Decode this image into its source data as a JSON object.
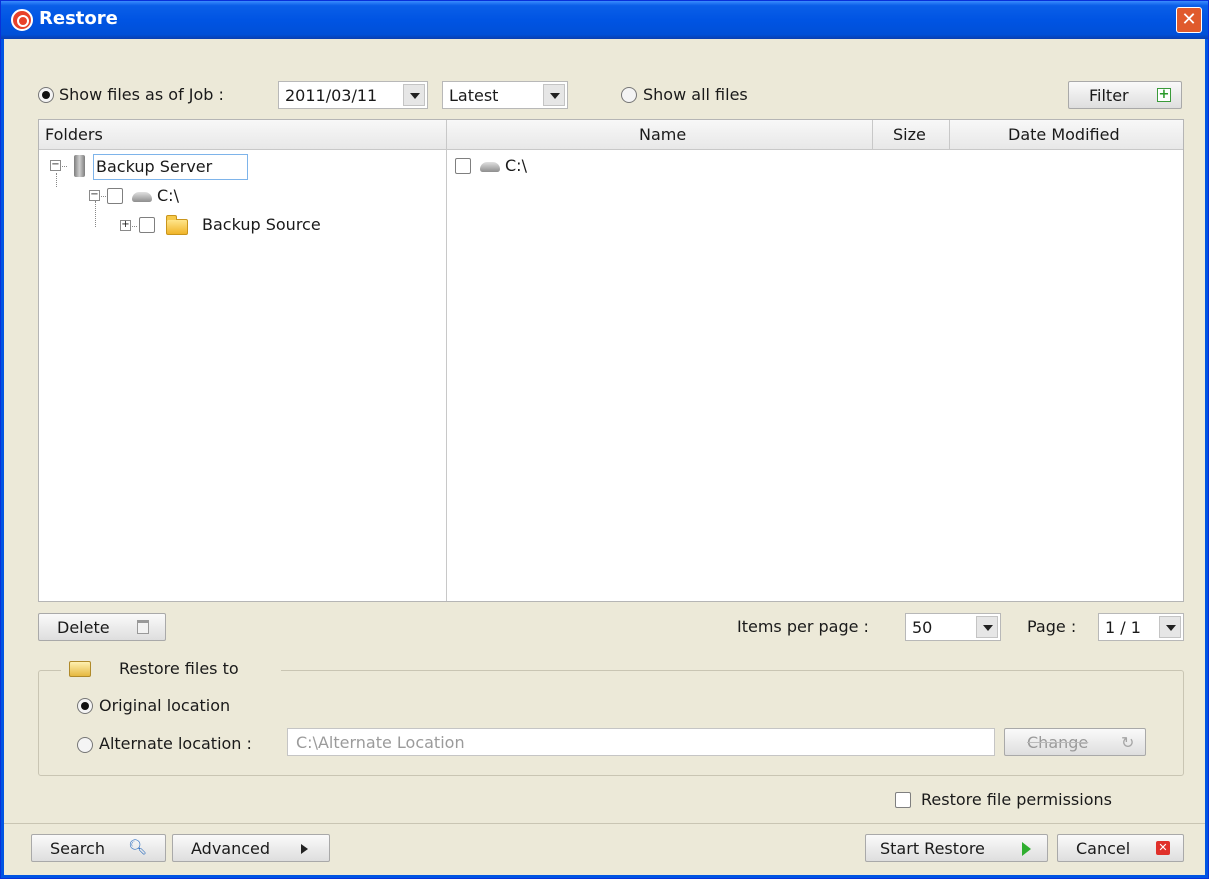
{
  "window": {
    "title": "Restore",
    "close_icon": "close-icon"
  },
  "job_selector": {
    "show_as_of_job_label": "Show files as of Job :",
    "job_date": "2011/03/11",
    "job_version": "Latest",
    "show_all_label": "Show all files",
    "filter_label": "Filter"
  },
  "tree": {
    "header": "Folders",
    "nodes": [
      {
        "label": "Backup Server",
        "icon": "server-icon"
      },
      {
        "label": "C:\\",
        "icon": "drive-icon"
      },
      {
        "label": "Backup Source",
        "icon": "folder-icon"
      }
    ]
  },
  "file_list": {
    "columns": [
      "Name",
      "Size",
      "Date Modified"
    ],
    "rows": [
      {
        "name": "C:\\",
        "icon": "drive-icon"
      }
    ]
  },
  "list_controls": {
    "delete_label": "Delete",
    "items_per_page_label": "Items per page :",
    "items_per_page": "50",
    "page_label": "Page :",
    "page_value": "1 / 1"
  },
  "restore_to": {
    "group_title": "Restore files to",
    "original_label": "Original location",
    "alternate_label": "Alternate location :",
    "alternate_path": "C:\\Alternate Location",
    "change_label": "Change"
  },
  "permissions_label": "Restore file permissions",
  "footer": {
    "search_label": "Search",
    "advanced_label": "Advanced",
    "start_label": "Start Restore",
    "cancel_label": "Cancel"
  }
}
